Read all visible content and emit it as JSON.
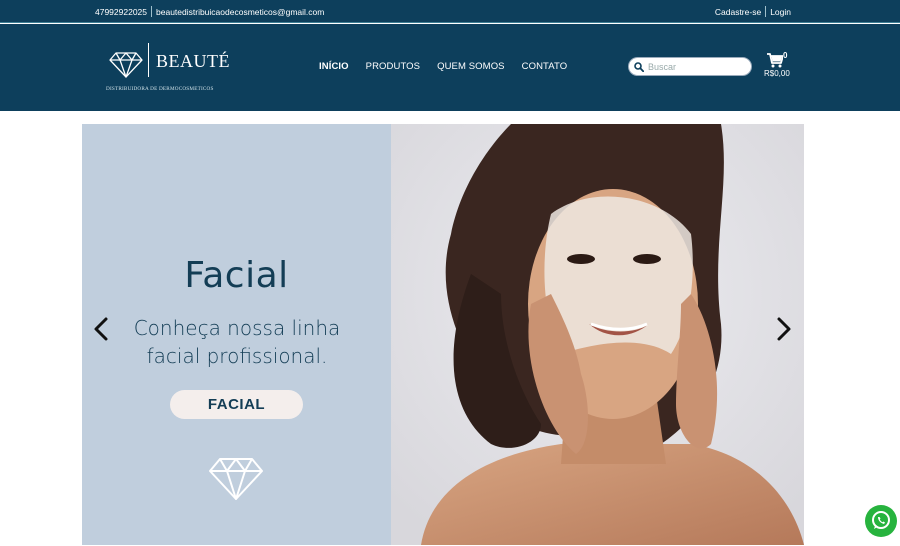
{
  "topbar": {
    "phone": "47992922025",
    "email": "beautedistribuicaodecosmeticos@gmail.com",
    "signup": "Cadastre-se",
    "login": "Login"
  },
  "logo": {
    "name": "BEAUTÉ",
    "tagline": "DISTRIBUIDORA DE DERMOCOSMETICOS"
  },
  "nav": {
    "items": [
      "INÍCIO",
      "PRODUTOS",
      "QUEM SOMOS",
      "CONTATO"
    ]
  },
  "search": {
    "placeholder": "Buscar"
  },
  "cart": {
    "count": "0",
    "total": "R$0,00"
  },
  "banner": {
    "title": "Facial",
    "subtitle": "Conheça nossa linha facial profissional.",
    "button": "FACIAL"
  },
  "colors": {
    "header_bg": "#0d3f5c",
    "panel_bg": "#c0cedd",
    "text_dark": "#133d55",
    "whatsapp": "#27b33e"
  },
  "icons": [
    "diamond-logo-icon",
    "search-icon",
    "cart-icon",
    "chevron-left-icon",
    "chevron-right-icon",
    "diamond-icon",
    "whatsapp-icon"
  ]
}
